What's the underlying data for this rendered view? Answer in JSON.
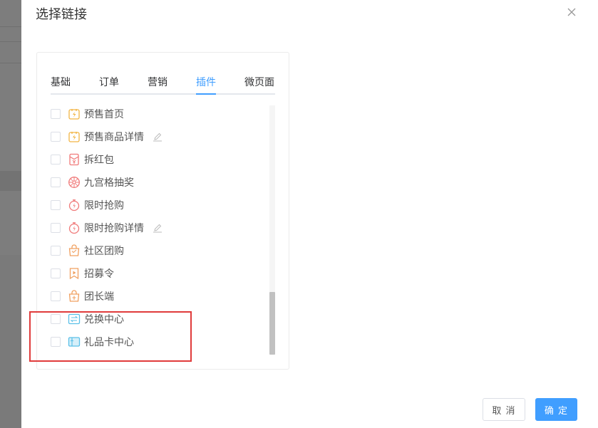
{
  "dialog": {
    "title": "选择链接",
    "cancel_label": "取 消",
    "confirm_label": "确 定"
  },
  "tabs": [
    {
      "label": "基础",
      "active": false
    },
    {
      "label": "订单",
      "active": false
    },
    {
      "label": "营销",
      "active": false
    },
    {
      "label": "插件",
      "active": true
    },
    {
      "label": "微页面",
      "active": false
    }
  ],
  "items": [
    {
      "label": "预售首页",
      "icon": "presale-icon",
      "editable": false,
      "checked": false
    },
    {
      "label": "预售商品详情",
      "icon": "presale-icon",
      "editable": true,
      "checked": false
    },
    {
      "label": "拆红包",
      "icon": "red-envelope-icon",
      "editable": false,
      "checked": false
    },
    {
      "label": "九宫格抽奖",
      "icon": "lottery-wheel-icon",
      "editable": false,
      "checked": false
    },
    {
      "label": "限时抢购",
      "icon": "stopwatch-icon",
      "editable": false,
      "checked": false
    },
    {
      "label": "限时抢购详情",
      "icon": "stopwatch-icon",
      "editable": true,
      "checked": false
    },
    {
      "label": "社区团购",
      "icon": "shopping-bag-icon",
      "editable": false,
      "checked": false
    },
    {
      "label": "招募令",
      "icon": "recruit-flag-icon",
      "editable": false,
      "checked": false
    },
    {
      "label": "团长端",
      "icon": "leader-bag-icon",
      "editable": false,
      "checked": false
    },
    {
      "label": "兑换中心",
      "icon": "exchange-icon",
      "editable": false,
      "checked": false
    },
    {
      "label": "礼品卡中心",
      "icon": "gift-card-icon",
      "editable": false,
      "checked": false
    }
  ],
  "colors": {
    "accent": "#409eff",
    "highlight": "#e03b3b",
    "presale": "#f2b544",
    "red": "#f07a7a",
    "orange": "#f0a060",
    "cyan": "#5bc0e8"
  }
}
